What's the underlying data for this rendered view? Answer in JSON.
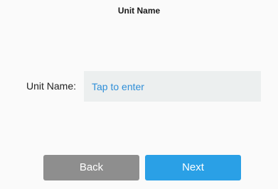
{
  "header": {
    "title": "Unit Name"
  },
  "form": {
    "unit_name_label": "Unit Name:",
    "unit_name_value": "",
    "unit_name_placeholder": "Tap to enter"
  },
  "actions": {
    "back_label": "Back",
    "next_label": "Next"
  },
  "colors": {
    "background": "#fafafa",
    "input_background": "#ecefef",
    "placeholder_text": "#2f8fd8",
    "back_button": "#8e8e8e",
    "next_button": "#2aa0e6"
  }
}
